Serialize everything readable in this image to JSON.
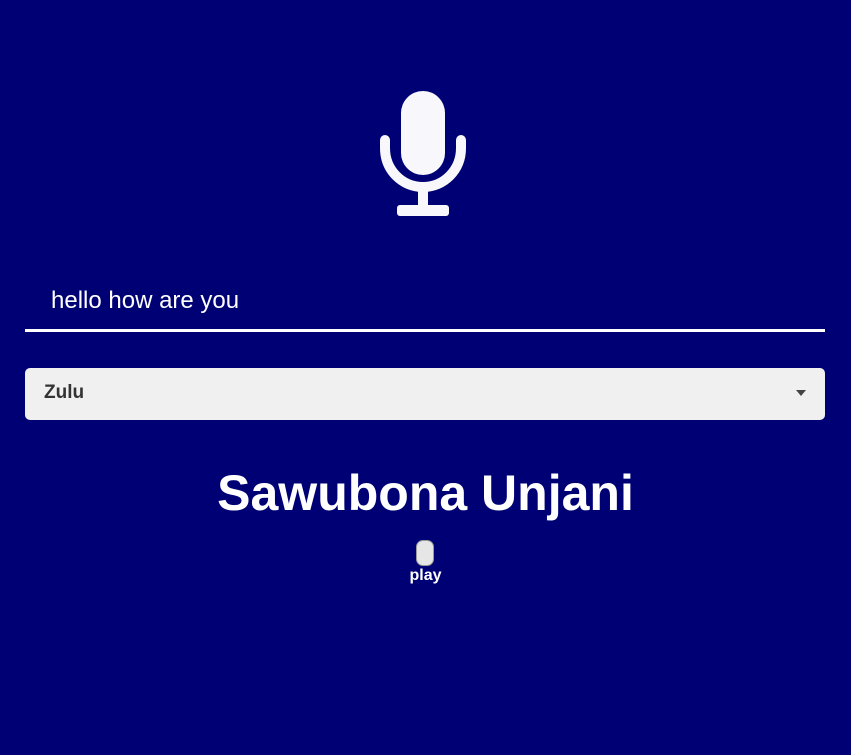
{
  "colors": {
    "background": "#000075",
    "foreground": "#ffffff",
    "select_background": "#f0f0f0"
  },
  "mic": {
    "icon": "microphone-icon"
  },
  "input": {
    "value": "hello how are you"
  },
  "language_select": {
    "selected": "Zulu",
    "icon": "caret-down-icon"
  },
  "translation": {
    "text": "Sawubona Unjani"
  },
  "audio": {
    "play_label": "play"
  }
}
